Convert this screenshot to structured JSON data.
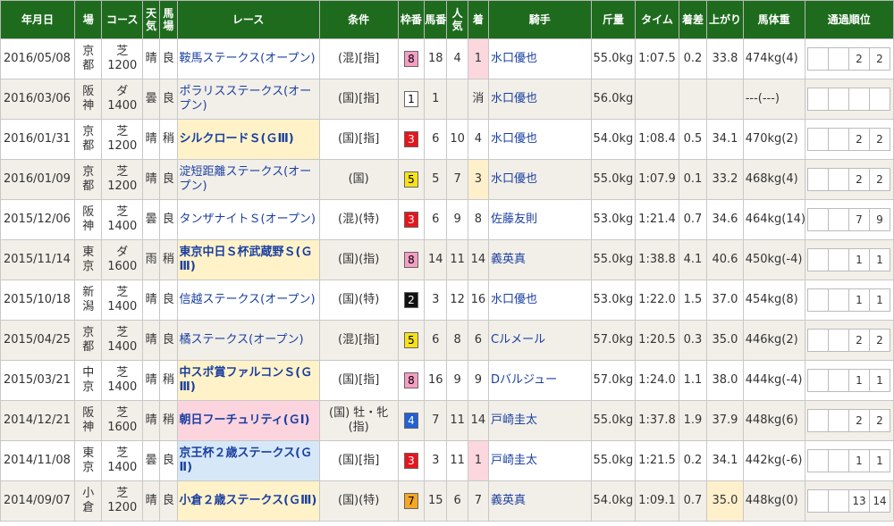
{
  "headers": [
    "年月日",
    "場",
    "コース",
    "天気",
    "馬場",
    "レース",
    "条件",
    "枠番",
    "馬番",
    "人気",
    "着",
    "騎手",
    "斤量",
    "タイム",
    "着差",
    "上がり",
    "馬体重",
    "通過順位"
  ],
  "races": [
    {
      "date": "2016/05/08",
      "venue": "京都",
      "course": "芝1200",
      "weather": "晴",
      "track": "良",
      "race": "鞍馬ステークス(オープン)",
      "grade": "",
      "cond": "(混)[指]",
      "waku": "8",
      "umaban": "18",
      "pop": "4",
      "rank": "1",
      "jockey": "水口優也",
      "weight": "55.0kg",
      "time": "1:07.5",
      "margin": "0.2",
      "agari": "33.8",
      "body": "474kg(4)",
      "pass": [
        "",
        "",
        "2",
        "2"
      ]
    },
    {
      "date": "2016/03/06",
      "venue": "阪神",
      "course": "ダ1400",
      "weather": "曇",
      "track": "良",
      "race": "ポラリスステークス(オープン)",
      "grade": "",
      "cond": "(国)[指]",
      "waku": "1",
      "umaban": "1",
      "pop": "",
      "rank": "消",
      "jockey": "水口優也",
      "weight": "56.0kg",
      "time": "",
      "margin": "",
      "agari": "",
      "body": "---(---)",
      "pass": [
        "",
        "",
        "",
        ""
      ]
    },
    {
      "date": "2016/01/31",
      "venue": "京都",
      "course": "芝1200",
      "weather": "晴",
      "track": "稍",
      "race": "シルクロードＳ(ＧⅢ)",
      "grade": "g3",
      "cond": "(国)[指]",
      "waku": "3",
      "umaban": "6",
      "pop": "10",
      "rank": "4",
      "jockey": "水口優也",
      "weight": "54.0kg",
      "time": "1:08.4",
      "margin": "0.5",
      "agari": "34.1",
      "body": "470kg(2)",
      "pass": [
        "",
        "",
        "2",
        "2"
      ]
    },
    {
      "date": "2016/01/09",
      "venue": "京都",
      "course": "芝1200",
      "weather": "晴",
      "track": "良",
      "race": "淀短距離ステークス(オープン)",
      "grade": "",
      "cond": "(国)",
      "waku": "5",
      "umaban": "5",
      "pop": "7",
      "rank": "3",
      "jockey": "水口優也",
      "weight": "55.0kg",
      "time": "1:07.9",
      "margin": "0.1",
      "agari": "33.2",
      "body": "468kg(4)",
      "pass": [
        "",
        "",
        "2",
        "2"
      ]
    },
    {
      "date": "2015/12/06",
      "venue": "阪神",
      "course": "芝1400",
      "weather": "曇",
      "track": "良",
      "race": "タンザナイトＳ(オープン)",
      "grade": "",
      "cond": "(混)(特)",
      "waku": "3",
      "umaban": "6",
      "pop": "9",
      "rank": "8",
      "jockey": "佐藤友則",
      "weight": "53.0kg",
      "time": "1:21.4",
      "margin": "0.7",
      "agari": "34.6",
      "body": "464kg(14)",
      "pass": [
        "",
        "",
        "7",
        "9"
      ]
    },
    {
      "date": "2015/11/14",
      "venue": "東京",
      "course": "ダ1600",
      "weather": "雨",
      "track": "稍",
      "race": "東京中日Ｓ杯武蔵野Ｓ(ＧⅢ)",
      "grade": "g3",
      "cond": "(国)(指)",
      "waku": "8",
      "umaban": "14",
      "pop": "11",
      "rank": "14",
      "jockey": "義英真",
      "weight": "55.0kg",
      "time": "1:38.8",
      "margin": "4.1",
      "agari": "40.6",
      "body": "450kg(-4)",
      "pass": [
        "",
        "",
        "1",
        "1"
      ]
    },
    {
      "date": "2015/10/18",
      "venue": "新潟",
      "course": "芝1400",
      "weather": "晴",
      "track": "良",
      "race": "信越ステークス(オープン)",
      "grade": "",
      "cond": "(国)(特)",
      "waku": "2",
      "umaban": "3",
      "pop": "12",
      "rank": "16",
      "jockey": "水口優也",
      "weight": "53.0kg",
      "time": "1:22.0",
      "margin": "1.5",
      "agari": "37.0",
      "body": "454kg(8)",
      "pass": [
        "",
        "",
        "1",
        "1"
      ]
    },
    {
      "date": "2015/04/25",
      "venue": "京都",
      "course": "芝1400",
      "weather": "晴",
      "track": "良",
      "race": "橘ステークス(オープン)",
      "grade": "",
      "cond": "(混)[指]",
      "waku": "5",
      "umaban": "6",
      "pop": "8",
      "rank": "6",
      "jockey": "Cルメール",
      "weight": "57.0kg",
      "time": "1:20.5",
      "margin": "0.3",
      "agari": "35.0",
      "body": "446kg(2)",
      "pass": [
        "",
        "",
        "2",
        "2"
      ]
    },
    {
      "date": "2015/03/21",
      "venue": "中京",
      "course": "芝1400",
      "weather": "晴",
      "track": "稍",
      "race": "中スポ賞ファルコンＳ(ＧⅢ)",
      "grade": "g3",
      "cond": "(国)[指]",
      "waku": "8",
      "umaban": "16",
      "pop": "9",
      "rank": "9",
      "jockey": "Dバルジュー",
      "weight": "57.0kg",
      "time": "1:24.0",
      "margin": "1.1",
      "agari": "38.0",
      "body": "444kg(-4)",
      "pass": [
        "",
        "",
        "1",
        "1"
      ]
    },
    {
      "date": "2014/12/21",
      "venue": "阪神",
      "course": "芝1600",
      "weather": "晴",
      "track": "稍",
      "race": "朝日フーチュリティ(ＧⅠ)",
      "grade": "g1",
      "cond": "(国) 牡・牝(指)",
      "waku": "4",
      "umaban": "7",
      "pop": "11",
      "rank": "14",
      "jockey": "戸崎圭太",
      "weight": "55.0kg",
      "time": "1:37.8",
      "margin": "1.9",
      "agari": "37.9",
      "body": "448kg(6)",
      "pass": [
        "",
        "",
        "2",
        "2"
      ]
    },
    {
      "date": "2014/11/08",
      "venue": "東京",
      "course": "芝1400",
      "weather": "曇",
      "track": "良",
      "race": "京王杯２歳ステークス(ＧⅡ)",
      "grade": "g2",
      "cond": "(国)[指]",
      "waku": "3",
      "umaban": "3",
      "pop": "11",
      "rank": "1",
      "jockey": "戸崎圭太",
      "weight": "55.0kg",
      "time": "1:21.5",
      "margin": "0.2",
      "agari": "34.1",
      "body": "442kg(-6)",
      "pass": [
        "",
        "",
        "1",
        "1"
      ]
    },
    {
      "date": "2014/09/07",
      "venue": "小倉",
      "course": "芝1200",
      "weather": "晴",
      "track": "良",
      "race": "小倉２歳ステークス(ＧⅢ)",
      "grade": "g3",
      "cond": "(国)(特)",
      "waku": "7",
      "umaban": "15",
      "pop": "6",
      "rank": "7",
      "jockey": "義英真",
      "weight": "54.0kg",
      "time": "1:09.1",
      "margin": "0.7",
      "agari": "35.0",
      "body": "448kg(0)",
      "pass": [
        "",
        "",
        "13",
        "14"
      ]
    }
  ],
  "waku_colors": {
    "1": {
      "bg": "#ffffff",
      "fg": "#000000"
    },
    "2": {
      "bg": "#111111",
      "fg": "#ffffff"
    },
    "3": {
      "bg": "#e8141c",
      "fg": "#ffffff"
    },
    "4": {
      "bg": "#2060d8",
      "fg": "#ffffff"
    },
    "5": {
      "bg": "#f7e21a",
      "fg": "#000000"
    },
    "6": {
      "bg": "#3aa83a",
      "fg": "#ffffff"
    },
    "7": {
      "bg": "#f5a623",
      "fg": "#000000"
    },
    "8": {
      "bg": "#f59ec4",
      "fg": "#000000"
    }
  }
}
